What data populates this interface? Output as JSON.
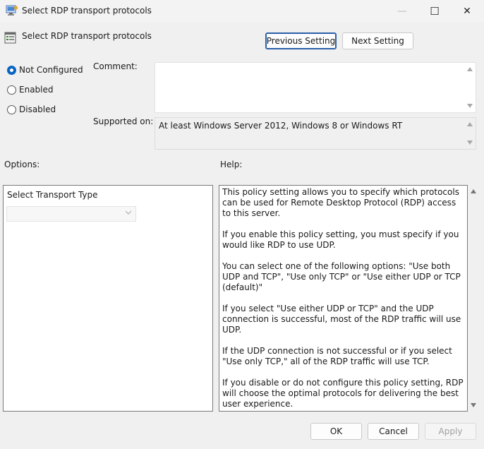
{
  "window": {
    "title": "Select RDP transport protocols",
    "minimize_glyph": "—",
    "maximize_glyph": "☐",
    "close_glyph": "✕"
  },
  "header": {
    "title": "Select RDP transport protocols",
    "previous_label": "Previous Setting",
    "next_label": "Next Setting"
  },
  "state": {
    "options": [
      {
        "label": "Not Configured",
        "checked": true
      },
      {
        "label": "Enabled",
        "checked": false
      },
      {
        "label": "Disabled",
        "checked": false
      }
    ]
  },
  "comment": {
    "label": "Comment:",
    "value": ""
  },
  "supported": {
    "label": "Supported on:",
    "value": "At least Windows Server 2012, Windows 8 or Windows RT"
  },
  "options_section": {
    "label": "Options:",
    "transport_label": "Select Transport Type",
    "transport_value": ""
  },
  "help": {
    "label": "Help:",
    "paragraphs": [
      "This policy setting allows you to specify which protocols can be used for Remote Desktop Protocol (RDP) access to this server.",
      "If you enable this policy setting, you must specify if you would like RDP to use UDP.",
      "You can select one of the following options: \"Use both UDP and TCP\", \"Use only TCP\" or \"Use either UDP or TCP (default)\"",
      "If you select \"Use either UDP or TCP\" and the UDP connection is successful, most of the RDP traffic will use UDP.",
      "If the UDP connection is not successful or if you select \"Use only TCP,\" all of the RDP traffic will use TCP.",
      "If you disable or do not configure this policy setting, RDP will choose the optimal protocols for delivering the best user experience."
    ]
  },
  "footer": {
    "ok_label": "OK",
    "cancel_label": "Cancel",
    "apply_label": "Apply"
  },
  "colors": {
    "accent": "#0a64c2",
    "focus_border": "#2a5fa8"
  }
}
